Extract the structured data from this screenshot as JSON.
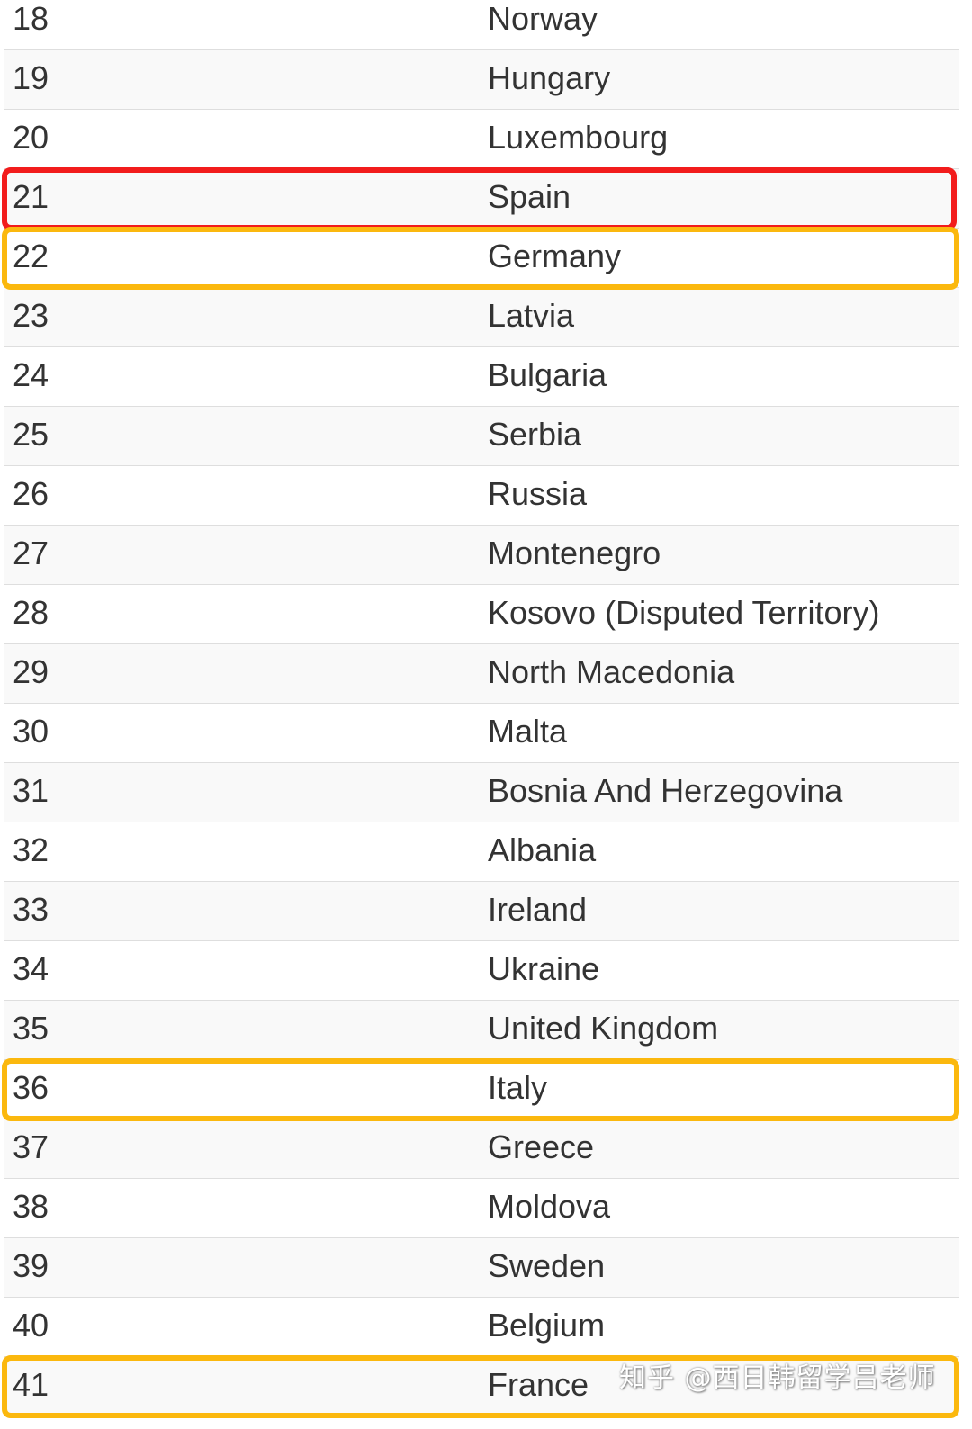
{
  "table": {
    "rows": [
      {
        "rank": "18",
        "country": "Norway"
      },
      {
        "rank": "19",
        "country": "Hungary"
      },
      {
        "rank": "20",
        "country": "Luxembourg"
      },
      {
        "rank": "21",
        "country": "Spain",
        "highlight": "red"
      },
      {
        "rank": "22",
        "country": "Germany",
        "highlight": "yellow"
      },
      {
        "rank": "23",
        "country": "Latvia"
      },
      {
        "rank": "24",
        "country": "Bulgaria"
      },
      {
        "rank": "25",
        "country": "Serbia"
      },
      {
        "rank": "26",
        "country": "Russia"
      },
      {
        "rank": "27",
        "country": "Montenegro"
      },
      {
        "rank": "28",
        "country": "Kosovo (Disputed Territory)"
      },
      {
        "rank": "29",
        "country": "North Macedonia"
      },
      {
        "rank": "30",
        "country": "Malta"
      },
      {
        "rank": "31",
        "country": "Bosnia And Herzegovina"
      },
      {
        "rank": "32",
        "country": "Albania"
      },
      {
        "rank": "33",
        "country": "Ireland"
      },
      {
        "rank": "34",
        "country": "Ukraine"
      },
      {
        "rank": "35",
        "country": "United Kingdom"
      },
      {
        "rank": "36",
        "country": "Italy",
        "highlight": "yellow"
      },
      {
        "rank": "37",
        "country": "Greece"
      },
      {
        "rank": "38",
        "country": "Moldova"
      },
      {
        "rank": "39",
        "country": "Sweden"
      },
      {
        "rank": "40",
        "country": "Belgium"
      },
      {
        "rank": "41",
        "country": "France",
        "highlight": "yellow"
      }
    ]
  },
  "colors": {
    "highlight_red": "#f21c1c",
    "highlight_yellow": "#fbb80e",
    "stripe": "#f9f9f9",
    "text": "#333333"
  },
  "watermark": "知乎 @西日韩留学吕老师"
}
